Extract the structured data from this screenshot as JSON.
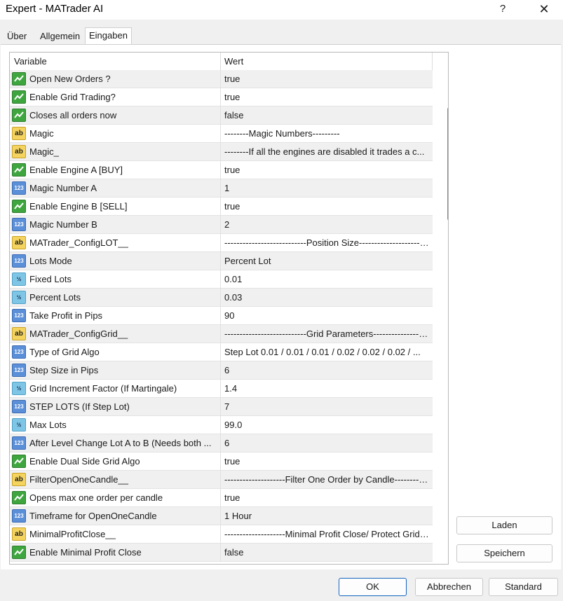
{
  "window": {
    "title": "Expert - MATrader AI",
    "help_label": "?",
    "close_label": "✕"
  },
  "tabs": [
    {
      "label": "Über",
      "active": false
    },
    {
      "label": "Allgemein",
      "active": false
    },
    {
      "label": "Eingaben",
      "active": true
    }
  ],
  "grid": {
    "headers": {
      "variable": "Variable",
      "value": "Wert"
    },
    "rows": [
      {
        "type": "bool",
        "name": "Open New Orders ?",
        "value": "true"
      },
      {
        "type": "bool",
        "name": "Enable Grid Trading?",
        "value": "true"
      },
      {
        "type": "bool",
        "name": "Closes all orders now",
        "value": "false"
      },
      {
        "type": "str",
        "name": "Magic",
        "value": "--------Magic Numbers---------"
      },
      {
        "type": "str",
        "name": "Magic_",
        "value": "--------If all the engines are disabled it trades a c..."
      },
      {
        "type": "bool",
        "name": "Enable Engine A  [BUY]",
        "value": "true"
      },
      {
        "type": "int",
        "name": "Magic Number  A",
        "value": "1"
      },
      {
        "type": "bool",
        "name": "Enable Engine B  [SELL]",
        "value": "true"
      },
      {
        "type": "int",
        "name": "Magic Number  B",
        "value": "2"
      },
      {
        "type": "str",
        "name": "MATrader_ConfigLOT__",
        "value": "---------------------------Position Size-------------------------..."
      },
      {
        "type": "int",
        "name": "Lots Mode",
        "value": "Percent Lot"
      },
      {
        "type": "dbl",
        "name": "Fixed Lots",
        "value": "0.01"
      },
      {
        "type": "dbl",
        "name": "Percent Lots",
        "value": "0.03"
      },
      {
        "type": "int",
        "name": "Take Profit in Pips",
        "value": "90"
      },
      {
        "type": "str",
        "name": "MATrader_ConfigGrid__",
        "value": "---------------------------Grid Parameters--------------------..."
      },
      {
        "type": "int",
        "name": "Type of Grid Algo",
        "value": "Step Lot       0.01 / 0.01 / 0.01 / 0.02 / 0.02 / 0.02 / ..."
      },
      {
        "type": "int",
        "name": "Step Size in Pips",
        "value": "6"
      },
      {
        "type": "dbl",
        "name": "Grid Increment Factor (If Martingale)",
        "value": "1.4"
      },
      {
        "type": "int",
        "name": "STEP LOTS (If Step Lot)",
        "value": "7"
      },
      {
        "type": "dbl",
        "name": "Max Lots",
        "value": "99.0"
      },
      {
        "type": "int",
        "name": "After Level Change Lot A to B (Needs both ...",
        "value": "6"
      },
      {
        "type": "bool",
        "name": "Enable Dual Side Grid Algo",
        "value": "true"
      },
      {
        "type": "str",
        "name": "FilterOpenOneCandle__",
        "value": "--------------------Filter One Order by Candle-----------..."
      },
      {
        "type": "bool",
        "name": "Opens max one order per candle",
        "value": "true"
      },
      {
        "type": "int",
        "name": "Timeframe for OpenOneCandle",
        "value": "1 Hour"
      },
      {
        "type": "str",
        "name": "MinimalProfitClose__",
        "value": "--------------------Minimal Profit Close/ Protect Grid -..."
      },
      {
        "type": "bool",
        "name": "Enable  Minimal Profit Close",
        "value": "false"
      }
    ]
  },
  "icons": {
    "bool": "bool-icon",
    "str": "string-icon",
    "int": "integer-icon",
    "dbl": "double-icon"
  },
  "icon_text": {
    "str": "ab",
    "int": "123",
    "dbl": "½"
  },
  "side_buttons": {
    "load": "Laden",
    "save": "Speichern"
  },
  "footer_buttons": {
    "ok": "OK",
    "cancel": "Abbrechen",
    "reset": "Standard"
  }
}
